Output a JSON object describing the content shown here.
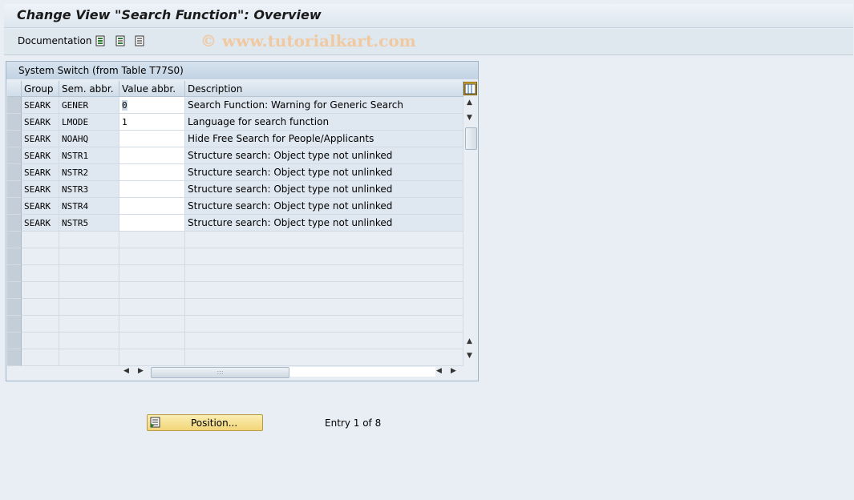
{
  "window": {
    "title": "Change View \"Search Function\": Overview"
  },
  "toolbar": {
    "documentation_label": "Documentation",
    "icons": [
      "select-all-icon",
      "select-block-icon",
      "deselect-all-icon"
    ],
    "watermark": "© www.tutorialkart.com"
  },
  "panel": {
    "title": "System Switch (from Table T77S0)"
  },
  "table": {
    "columns": [
      "Group",
      "Sem. abbr.",
      "Value abbr.",
      "Description"
    ],
    "rows": [
      {
        "group": "SEARK",
        "sem": "GENER",
        "value": "0",
        "desc": "Search Function: Warning for Generic Search"
      },
      {
        "group": "SEARK",
        "sem": "LMODE",
        "value": "1",
        "desc": "Language for search function"
      },
      {
        "group": "SEARK",
        "sem": "NOAHQ",
        "value": "",
        "desc": "Hide Free Search for People/Applicants"
      },
      {
        "group": "SEARK",
        "sem": "NSTR1",
        "value": "",
        "desc": "Structure search: Object type not unlinked"
      },
      {
        "group": "SEARK",
        "sem": "NSTR2",
        "value": "",
        "desc": "Structure search: Object type not unlinked"
      },
      {
        "group": "SEARK",
        "sem": "NSTR3",
        "value": "",
        "desc": "Structure search: Object type not unlinked"
      },
      {
        "group": "SEARK",
        "sem": "NSTR4",
        "value": "",
        "desc": "Structure search: Object type not unlinked"
      },
      {
        "group": "SEARK",
        "sem": "NSTR5",
        "value": "",
        "desc": "Structure search: Object type not unlinked"
      }
    ],
    "empty_rows": 8
  },
  "footer": {
    "position_label": "Position...",
    "entry_text": "Entry 1 of 8"
  },
  "colors": {
    "button": "#f2d577",
    "header": "#cfdce8"
  }
}
